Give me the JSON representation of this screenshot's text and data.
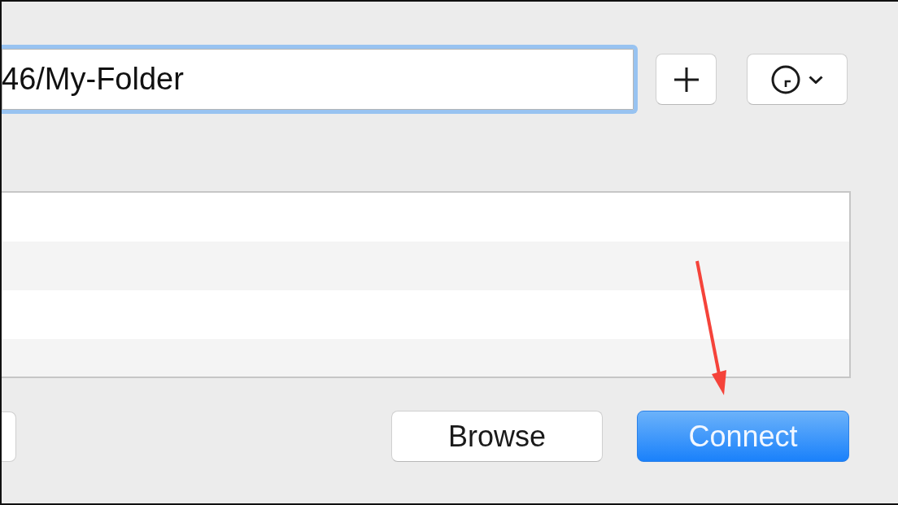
{
  "address_field": {
    "value": "46/My-Folder",
    "focused": true
  },
  "buttons": [
    {
      "label": "Browse",
      "primary": false
    },
    {
      "label": "Connect",
      "primary": true
    }
  ],
  "annotations": [
    {
      "kind": "arrow"
    }
  ]
}
